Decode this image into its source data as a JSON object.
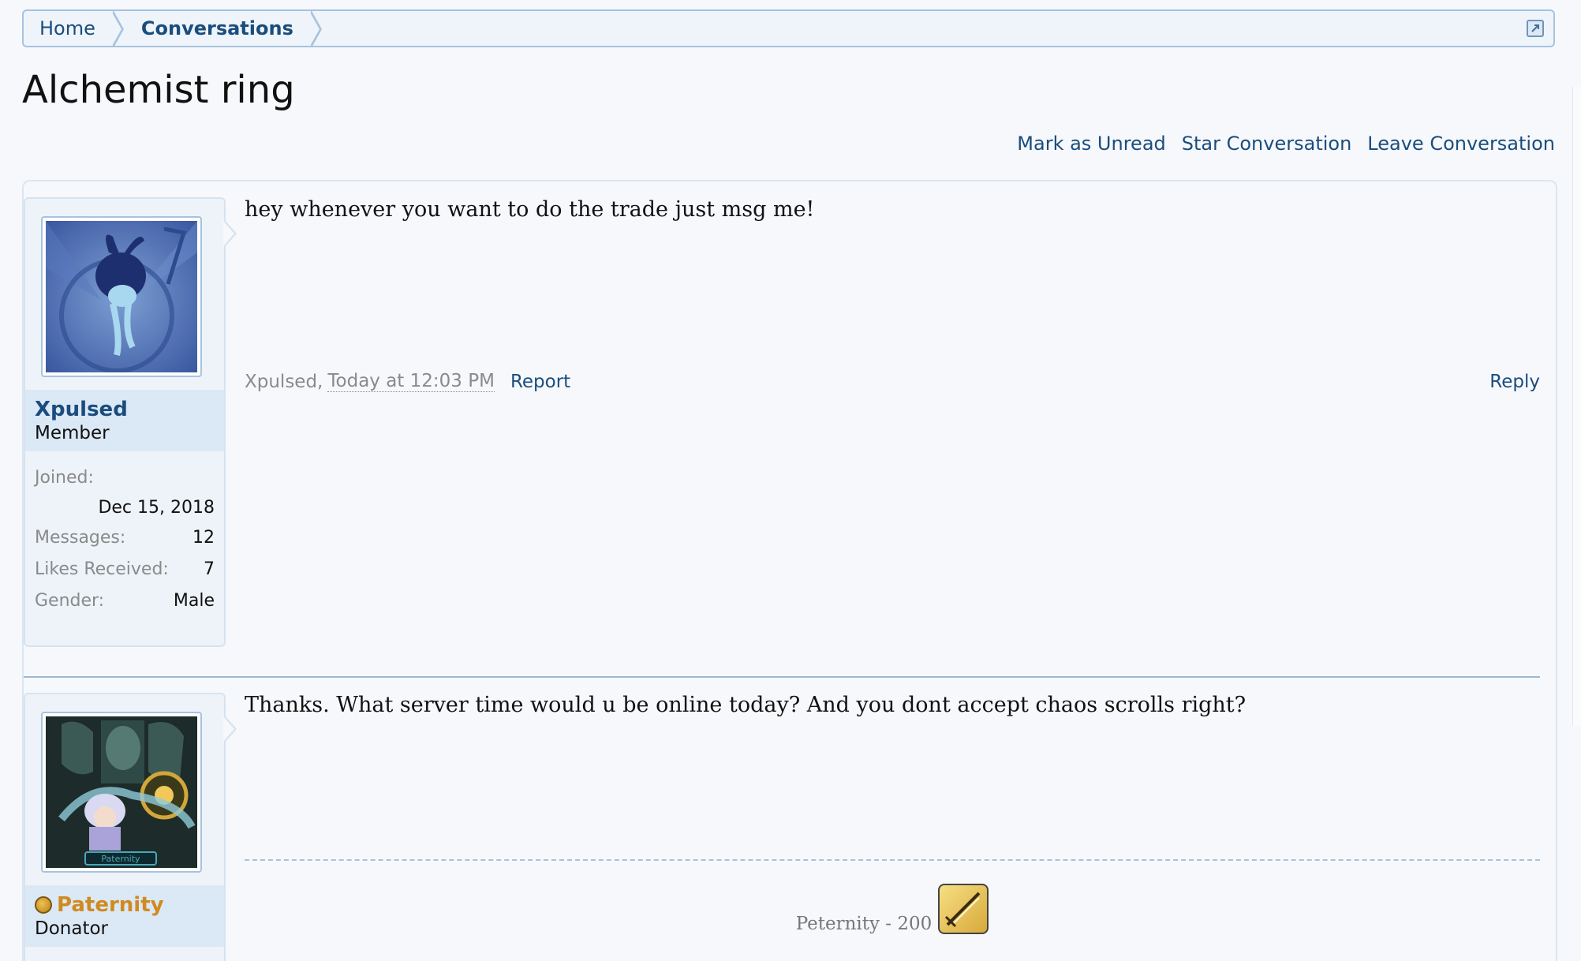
{
  "breadcrumb": {
    "items": [
      "Home",
      "Conversations"
    ]
  },
  "page": {
    "title": "Alchemist ring"
  },
  "actions": {
    "mark_unread": "Mark as Unread",
    "star": "Star Conversation",
    "leave": "Leave Conversation"
  },
  "messages": [
    {
      "username": "Xpulsed",
      "user_title": "Member",
      "stats": {
        "joined_label": "Joined:",
        "joined_value": "Dec 15, 2018",
        "messages_label": "Messages:",
        "messages_value": "12",
        "likes_label": "Likes Received:",
        "likes_value": "7",
        "gender_label": "Gender:",
        "gender_value": "Male"
      },
      "body": "hey whenever you want to do the trade just msg me!",
      "meta_author": "Xpulsed,",
      "meta_time": "Today at 12:03 PM",
      "report": "Report",
      "reply": "Reply"
    },
    {
      "username": "Paternity",
      "user_title": "Donator",
      "body": "Thanks. What server time would u be online today? And you dont accept chaos scrolls right?",
      "signature_text": "Peternity - 200",
      "avatar_label": "Paternity"
    }
  ],
  "colors": {
    "link": "#1a4d7d",
    "donator": "#d08a20",
    "border": "#a7c3de"
  }
}
